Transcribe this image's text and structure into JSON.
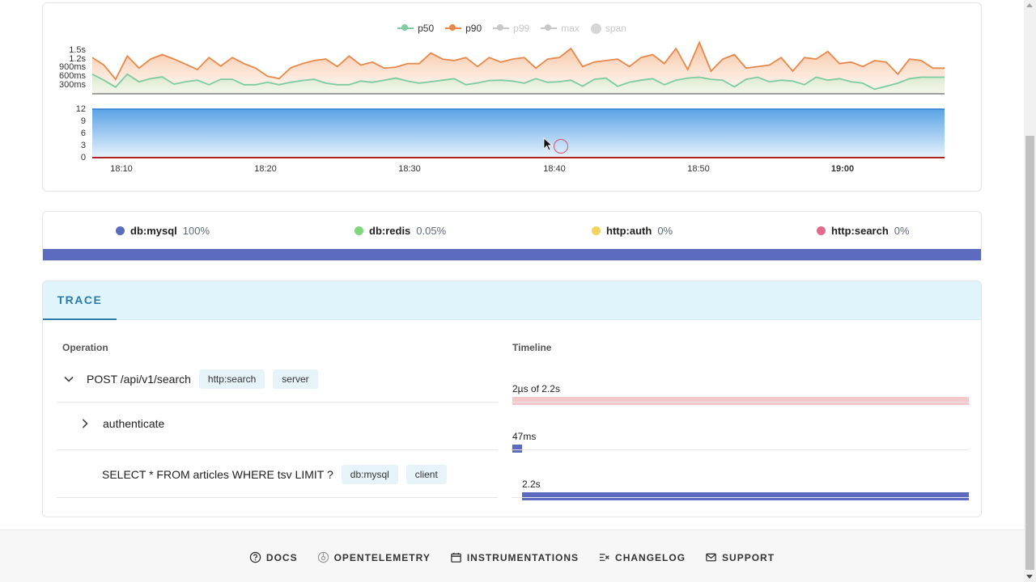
{
  "chart": {
    "legend": [
      {
        "label": "p50",
        "color": "#7ecba1",
        "active": true
      },
      {
        "label": "p90",
        "color": "#e8884a",
        "active": true
      },
      {
        "label": "p99",
        "color": "#c8c8c8",
        "active": false
      },
      {
        "label": "max",
        "color": "#c8c8c8",
        "active": false
      },
      {
        "label": "span",
        "color": "#d6d6d6",
        "active": false
      }
    ],
    "duration_ticks": [
      "1.5s",
      "1.2s",
      "900ms",
      "600ms",
      "300ms"
    ],
    "rate_ticks": [
      "12",
      "9",
      "6",
      "3",
      "0"
    ],
    "time_ticks": [
      "18:10",
      "18:20",
      "18:30",
      "18:40",
      "18:50",
      "19:00"
    ]
  },
  "chart_data": {
    "type": "area",
    "x_labels": [
      "18:10",
      "18:20",
      "18:30",
      "18:40",
      "18:50",
      "19:00"
    ],
    "duration_axis": {
      "ticks": [
        "1.5s",
        "1.2s",
        "900ms",
        "600ms",
        "300ms"
      ],
      "ylim_ms": [
        0,
        1500
      ]
    },
    "series": [
      {
        "name": "p90",
        "color": "#e8884a",
        "values_ms": [
          1200,
          950,
          480,
          1250,
          850,
          1150,
          1300,
          1150,
          980,
          800,
          1200,
          920,
          1200,
          1000,
          850,
          580,
          500,
          860,
          1000,
          1100,
          1150,
          900,
          1250,
          950,
          1050,
          850,
          880,
          1000,
          1000,
          1350,
          1150,
          1100,
          1200,
          900,
          1200,
          1050,
          1150,
          1200,
          850,
          1150,
          1200,
          1500,
          900,
          1050,
          1100,
          1150,
          900,
          1200,
          1300,
          1000,
          1500,
          800,
          1700,
          750,
          1150,
          1300,
          850,
          900,
          950,
          1200,
          750,
          1200,
          1150,
          1400,
          1000,
          1050,
          900,
          1100,
          1050,
          650,
          1150,
          1100,
          850,
          850
        ],
        "approximate": true
      },
      {
        "name": "p50",
        "color": "#7ecba1",
        "values_ms": [
          650,
          450,
          220,
          650,
          400,
          500,
          560,
          320,
          400,
          450,
          300,
          480,
          480,
          300,
          300,
          380,
          300,
          380,
          440,
          480,
          350,
          300,
          300,
          420,
          380,
          450,
          520,
          420,
          350,
          400,
          450,
          500,
          300,
          360,
          440,
          450,
          420,
          350,
          500,
          380,
          400,
          450,
          250,
          480,
          520,
          250,
          380,
          450,
          500,
          300,
          450,
          520,
          550,
          480,
          450,
          230,
          480,
          550,
          400,
          450,
          420,
          300,
          550,
          450,
          500,
          400,
          350,
          150,
          250,
          350,
          500,
          550,
          550,
          550
        ],
        "approximate": true
      }
    ],
    "rate_axis": {
      "ticks": [
        "12",
        "9",
        "6",
        "3",
        "0"
      ],
      "ylim": [
        0,
        12
      ]
    },
    "rate_series": {
      "name": "span",
      "value": 12
    }
  },
  "distribution": [
    {
      "name": "db:mysql",
      "pct": "100%",
      "color": "#5c6bc0"
    },
    {
      "name": "db:redis",
      "pct": "0.05%",
      "color": "#7ed77e"
    },
    {
      "name": "http:auth",
      "pct": "0%",
      "color": "#f2d45c"
    },
    {
      "name": "http:search",
      "pct": "0%",
      "color": "#e06b8b"
    }
  ],
  "trace": {
    "tab": "TRACE",
    "col_operation": "Operation",
    "col_timeline": "Timeline",
    "spans": [
      {
        "name": "POST /api/v1/search",
        "badges": [
          "http:search",
          "server"
        ],
        "timing": "2µs of 2.2s",
        "bar_color": "#f4c7cb",
        "bar_start": 0.0,
        "bar_fraction": 1.0
      },
      {
        "name": "authenticate",
        "badges": [],
        "timing": "47ms",
        "bar_color": "#5c6bc0",
        "bar_start": 0.0,
        "bar_fraction": 0.021
      },
      {
        "name": "SELECT * FROM articles WHERE tsv LIMIT ?",
        "badges": [
          "db:mysql",
          "client"
        ],
        "timing": "2.2s",
        "bar_color": "#5c6bc0",
        "bar_start": 0.021,
        "bar_fraction": 0.979
      }
    ]
  },
  "footer": [
    {
      "label": "DOCS",
      "icon": "help-circle-icon"
    },
    {
      "label": "OPENTELEMETRY",
      "icon": "opentelemetry-icon"
    },
    {
      "label": "INSTRUMENTATIONS",
      "icon": "calendar-icon"
    },
    {
      "label": "CHANGELOG",
      "icon": "changelog-icon"
    },
    {
      "label": "SUPPORT",
      "icon": "mail-icon"
    }
  ]
}
